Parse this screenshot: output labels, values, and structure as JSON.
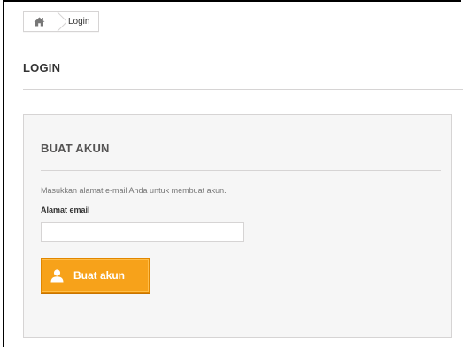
{
  "breadcrumb": {
    "home_icon": "home-icon",
    "current": "Login"
  },
  "page": {
    "title": "LOGIN"
  },
  "create_account": {
    "title": "BUAT AKUN",
    "description": "Masukkan alamat e-mail Anda untuk membuat akun.",
    "email_label": "Alamat email",
    "email_value": "",
    "button_label": "Buat akun",
    "button_icon": "user-icon",
    "button_color": "#f7a21a"
  }
}
